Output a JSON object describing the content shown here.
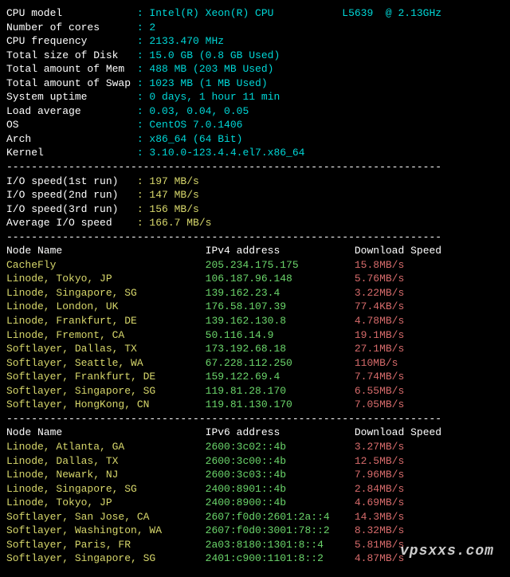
{
  "sysinfo": [
    {
      "label": "CPU model            ",
      "value": "Intel(R) Xeon(R) CPU           L5639  @ 2.13GHz"
    },
    {
      "label": "Number of cores      ",
      "value": "2"
    },
    {
      "label": "CPU frequency        ",
      "value": "2133.470 MHz"
    },
    {
      "label": "Total size of Disk   ",
      "value": "15.0 GB (0.8 GB Used)"
    },
    {
      "label": "Total amount of Mem  ",
      "value": "488 MB (203 MB Used)"
    },
    {
      "label": "Total amount of Swap ",
      "value": "1023 MB (1 MB Used)"
    },
    {
      "label": "System uptime        ",
      "value": "0 days, 1 hour 11 min"
    },
    {
      "label": "Load average         ",
      "value": "0.03, 0.04, 0.05"
    },
    {
      "label": "OS                   ",
      "value": "CentOS 7.0.1406"
    },
    {
      "label": "Arch                 ",
      "value": "x86_64 (64 Bit)"
    },
    {
      "label": "Kernel               ",
      "value": "3.10.0-123.4.4.el7.x86_64"
    }
  ],
  "dashes": "----------------------------------------------------------------------",
  "io": [
    {
      "label": "I/O speed(1st run)   ",
      "value": "197 MB/s"
    },
    {
      "label": "I/O speed(2nd run)   ",
      "value": "147 MB/s"
    },
    {
      "label": "I/O speed(3rd run)   ",
      "value": "156 MB/s"
    },
    {
      "label": "Average I/O speed    ",
      "value": "166.7 MB/s"
    }
  ],
  "ipv4_header": {
    "name": "Node Name",
    "addr": "IPv4 address",
    "speed": "Download Speed"
  },
  "ipv4": [
    {
      "name": "CacheFly",
      "addr": "205.234.175.175",
      "speed": "15.8MB/s"
    },
    {
      "name": "Linode, Tokyo, JP",
      "addr": "106.187.96.148",
      "speed": "5.76MB/s"
    },
    {
      "name": "Linode, Singapore, SG",
      "addr": "139.162.23.4",
      "speed": "3.22MB/s"
    },
    {
      "name": "Linode, London, UK",
      "addr": "176.58.107.39",
      "speed": "77.4KB/s"
    },
    {
      "name": "Linode, Frankfurt, DE",
      "addr": "139.162.130.8",
      "speed": "4.78MB/s"
    },
    {
      "name": "Linode, Fremont, CA",
      "addr": "50.116.14.9",
      "speed": "19.1MB/s"
    },
    {
      "name": "Softlayer, Dallas, TX",
      "addr": "173.192.68.18",
      "speed": "27.1MB/s"
    },
    {
      "name": "Softlayer, Seattle, WA",
      "addr": "67.228.112.250",
      "speed": "110MB/s"
    },
    {
      "name": "Softlayer, Frankfurt, DE",
      "addr": "159.122.69.4",
      "speed": "7.74MB/s"
    },
    {
      "name": "Softlayer, Singapore, SG",
      "addr": "119.81.28.170",
      "speed": "6.55MB/s"
    },
    {
      "name": "Softlayer, HongKong, CN",
      "addr": "119.81.130.170",
      "speed": "7.05MB/s"
    }
  ],
  "ipv6_header": {
    "name": "Node Name",
    "addr": "IPv6 address",
    "speed": "Download Speed"
  },
  "ipv6": [
    {
      "name": "Linode, Atlanta, GA",
      "addr": "2600:3c02::4b",
      "speed": "3.27MB/s"
    },
    {
      "name": "Linode, Dallas, TX",
      "addr": "2600:3c00::4b",
      "speed": "12.5MB/s"
    },
    {
      "name": "Linode, Newark, NJ",
      "addr": "2600:3c03::4b",
      "speed": "7.96MB/s"
    },
    {
      "name": "Linode, Singapore, SG",
      "addr": "2400:8901::4b",
      "speed": "2.84MB/s"
    },
    {
      "name": "Linode, Tokyo, JP",
      "addr": "2400:8900::4b",
      "speed": "4.69MB/s"
    },
    {
      "name": "Softlayer, San Jose, CA",
      "addr": "2607:f0d0:2601:2a::4",
      "speed": "14.3MB/s"
    },
    {
      "name": "Softlayer, Washington, WA",
      "addr": "2607:f0d0:3001:78::2",
      "speed": "8.32MB/s"
    },
    {
      "name": "Softlayer, Paris, FR",
      "addr": "2a03:8180:1301:8::4",
      "speed": "5.81MB/s"
    },
    {
      "name": "Softlayer, Singapore, SG",
      "addr": "2401:c900:1101:8::2",
      "speed": "4.87MB/s"
    }
  ],
  "watermark": "vpsxxs.com"
}
